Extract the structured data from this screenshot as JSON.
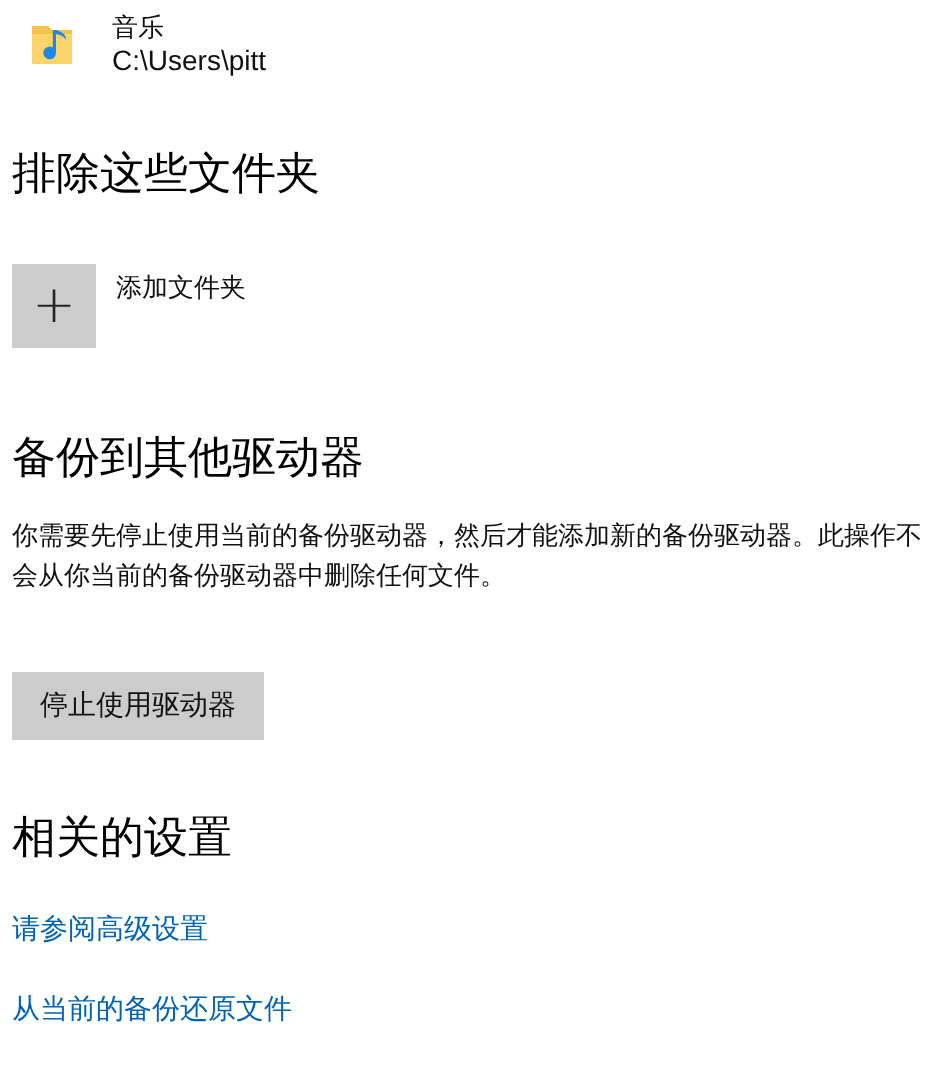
{
  "folder": {
    "name": "音乐",
    "path": "C:\\Users\\pitt"
  },
  "exclude": {
    "heading": "排除这些文件夹",
    "add_button": "+",
    "add_label": "添加文件夹"
  },
  "backup": {
    "heading": "备份到其他驱动器",
    "description": "你需要先停止使用当前的备份驱动器，然后才能添加新的备份驱动器。此操作不会从你当前的备份驱动器中删除任何文件。",
    "button": "停止使用驱动器"
  },
  "related": {
    "heading": "相关的设置",
    "links": [
      "请参阅高级设置",
      "从当前的备份还原文件"
    ]
  }
}
